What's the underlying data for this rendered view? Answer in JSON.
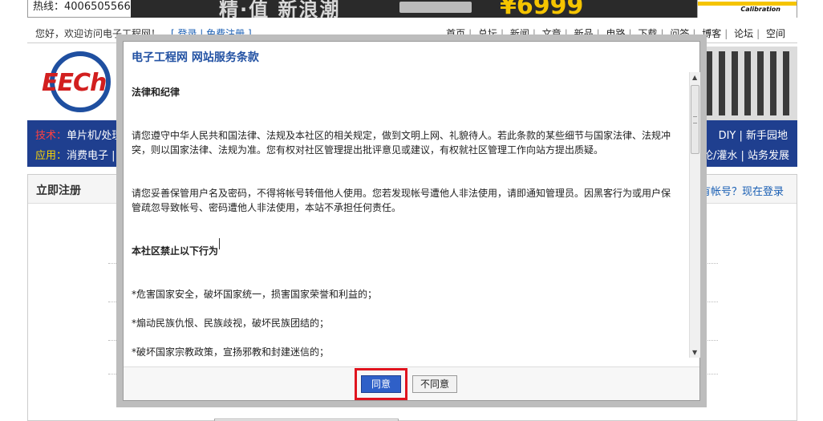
{
  "top": {
    "hotline": "热线：4006505566",
    "banner_text": "精·值 新浪潮",
    "banner_price": "¥6999",
    "banner_right_text": "Calibration"
  },
  "welcome": {
    "greeting": "您好，欢迎访问电子工程网！",
    "auth_links": "[ 登录 | 免费注册 ]"
  },
  "topnav": [
    "首页",
    "总坛",
    "新闻",
    "文章",
    "新品",
    "电路",
    "下载",
    "问答",
    "博客",
    "论坛",
    "空间"
  ],
  "logo": {
    "text": "EECh"
  },
  "blueband": {
    "row1_label": "技术：",
    "row1_text": "单片机/处理器",
    "row2_label": "应用：",
    "row2_text": "消费电子 | 工",
    "right1": "DIY | 新手园地",
    "right2": "讨论/灌水 | 站务发展"
  },
  "register": {
    "title": "立即注册",
    "login_link": "已有帐号？现在登录"
  },
  "dialog": {
    "title": "电子工程网  网站服务条款",
    "sections": [
      {
        "text": "法律和纪律",
        "heading": true
      },
      {
        "text": "请您遵守中华人民共和国法律、法规及本社区的相关规定，做到文明上网、礼貌待人。若此条款的某些细节与国家法律、法规冲突，则以国家法律、法规为准。您有权对社区管理提出批评意见或建议，有权就社区管理工作向站方提出质疑。",
        "heading": false
      },
      {
        "text": "请您妥善保管用户名及密码，不得将帐号转借他人使用。您若发现帐号遭他人非法使用，请即通知管理员。因黑客行为或用户保管疏忽导致帐号、密码遭他人非法使用，本站不承担任何责任。",
        "heading": false
      },
      {
        "text": "本社区禁止以下行为",
        "heading": true
      },
      {
        "text": "*危害国家安全，破坏国家统一，损害国家荣誉和利益的；",
        "heading": false
      },
      {
        "text": "*煽动民族仇恨、民族歧视，破坏民族团结的；",
        "heading": false
      },
      {
        "text": "*破坏国家宗教政策，宣扬邪教和封建迷信的；",
        "heading": false
      }
    ],
    "agree_label": "同意",
    "disagree_label": "不同意",
    "highlight_color": "#e0141e",
    "agree_color": "#2f60c8"
  }
}
